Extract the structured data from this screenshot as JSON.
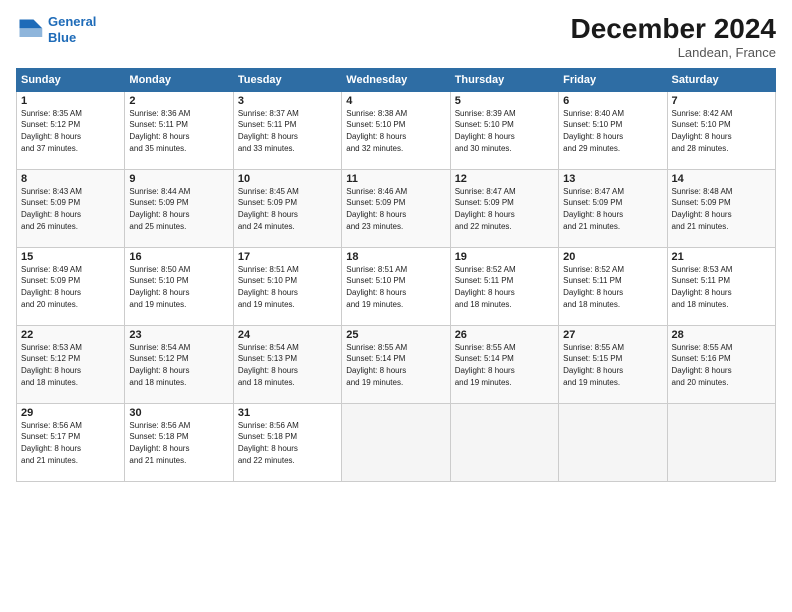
{
  "logo": {
    "line1": "General",
    "line2": "Blue"
  },
  "title": "December 2024",
  "location": "Landean, France",
  "days_of_week": [
    "Sunday",
    "Monday",
    "Tuesday",
    "Wednesday",
    "Thursday",
    "Friday",
    "Saturday"
  ],
  "weeks": [
    [
      {
        "day": 1,
        "info": "Sunrise: 8:35 AM\nSunset: 5:12 PM\nDaylight: 8 hours\nand 37 minutes."
      },
      {
        "day": 2,
        "info": "Sunrise: 8:36 AM\nSunset: 5:11 PM\nDaylight: 8 hours\nand 35 minutes."
      },
      {
        "day": 3,
        "info": "Sunrise: 8:37 AM\nSunset: 5:11 PM\nDaylight: 8 hours\nand 33 minutes."
      },
      {
        "day": 4,
        "info": "Sunrise: 8:38 AM\nSunset: 5:10 PM\nDaylight: 8 hours\nand 32 minutes."
      },
      {
        "day": 5,
        "info": "Sunrise: 8:39 AM\nSunset: 5:10 PM\nDaylight: 8 hours\nand 30 minutes."
      },
      {
        "day": 6,
        "info": "Sunrise: 8:40 AM\nSunset: 5:10 PM\nDaylight: 8 hours\nand 29 minutes."
      },
      {
        "day": 7,
        "info": "Sunrise: 8:42 AM\nSunset: 5:10 PM\nDaylight: 8 hours\nand 28 minutes."
      }
    ],
    [
      {
        "day": 8,
        "info": "Sunrise: 8:43 AM\nSunset: 5:09 PM\nDaylight: 8 hours\nand 26 minutes."
      },
      {
        "day": 9,
        "info": "Sunrise: 8:44 AM\nSunset: 5:09 PM\nDaylight: 8 hours\nand 25 minutes."
      },
      {
        "day": 10,
        "info": "Sunrise: 8:45 AM\nSunset: 5:09 PM\nDaylight: 8 hours\nand 24 minutes."
      },
      {
        "day": 11,
        "info": "Sunrise: 8:46 AM\nSunset: 5:09 PM\nDaylight: 8 hours\nand 23 minutes."
      },
      {
        "day": 12,
        "info": "Sunrise: 8:47 AM\nSunset: 5:09 PM\nDaylight: 8 hours\nand 22 minutes."
      },
      {
        "day": 13,
        "info": "Sunrise: 8:47 AM\nSunset: 5:09 PM\nDaylight: 8 hours\nand 21 minutes."
      },
      {
        "day": 14,
        "info": "Sunrise: 8:48 AM\nSunset: 5:09 PM\nDaylight: 8 hours\nand 21 minutes."
      }
    ],
    [
      {
        "day": 15,
        "info": "Sunrise: 8:49 AM\nSunset: 5:09 PM\nDaylight: 8 hours\nand 20 minutes."
      },
      {
        "day": 16,
        "info": "Sunrise: 8:50 AM\nSunset: 5:10 PM\nDaylight: 8 hours\nand 19 minutes."
      },
      {
        "day": 17,
        "info": "Sunrise: 8:51 AM\nSunset: 5:10 PM\nDaylight: 8 hours\nand 19 minutes."
      },
      {
        "day": 18,
        "info": "Sunrise: 8:51 AM\nSunset: 5:10 PM\nDaylight: 8 hours\nand 19 minutes."
      },
      {
        "day": 19,
        "info": "Sunrise: 8:52 AM\nSunset: 5:11 PM\nDaylight: 8 hours\nand 18 minutes."
      },
      {
        "day": 20,
        "info": "Sunrise: 8:52 AM\nSunset: 5:11 PM\nDaylight: 8 hours\nand 18 minutes."
      },
      {
        "day": 21,
        "info": "Sunrise: 8:53 AM\nSunset: 5:11 PM\nDaylight: 8 hours\nand 18 minutes."
      }
    ],
    [
      {
        "day": 22,
        "info": "Sunrise: 8:53 AM\nSunset: 5:12 PM\nDaylight: 8 hours\nand 18 minutes."
      },
      {
        "day": 23,
        "info": "Sunrise: 8:54 AM\nSunset: 5:12 PM\nDaylight: 8 hours\nand 18 minutes."
      },
      {
        "day": 24,
        "info": "Sunrise: 8:54 AM\nSunset: 5:13 PM\nDaylight: 8 hours\nand 18 minutes."
      },
      {
        "day": 25,
        "info": "Sunrise: 8:55 AM\nSunset: 5:14 PM\nDaylight: 8 hours\nand 19 minutes."
      },
      {
        "day": 26,
        "info": "Sunrise: 8:55 AM\nSunset: 5:14 PM\nDaylight: 8 hours\nand 19 minutes."
      },
      {
        "day": 27,
        "info": "Sunrise: 8:55 AM\nSunset: 5:15 PM\nDaylight: 8 hours\nand 19 minutes."
      },
      {
        "day": 28,
        "info": "Sunrise: 8:55 AM\nSunset: 5:16 PM\nDaylight: 8 hours\nand 20 minutes."
      }
    ],
    [
      {
        "day": 29,
        "info": "Sunrise: 8:56 AM\nSunset: 5:17 PM\nDaylight: 8 hours\nand 21 minutes."
      },
      {
        "day": 30,
        "info": "Sunrise: 8:56 AM\nSunset: 5:18 PM\nDaylight: 8 hours\nand 21 minutes."
      },
      {
        "day": 31,
        "info": "Sunrise: 8:56 AM\nSunset: 5:18 PM\nDaylight: 8 hours\nand 22 minutes."
      },
      null,
      null,
      null,
      null
    ]
  ]
}
